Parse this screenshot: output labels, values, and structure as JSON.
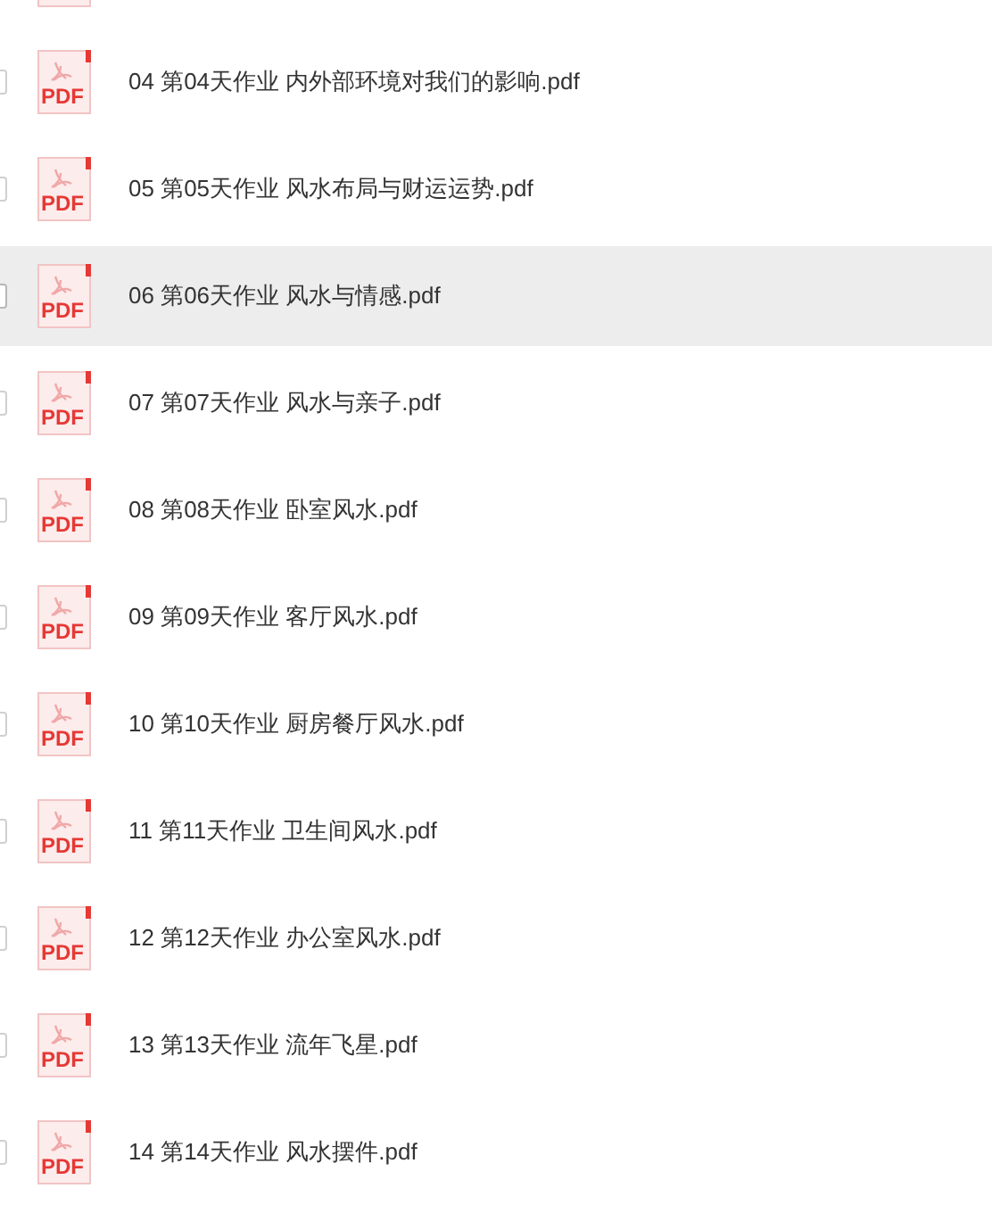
{
  "files": [
    {
      "name": "04 第04天作业 内外部环境对我们的影响.pdf",
      "icon_text": "PDF",
      "selected": false
    },
    {
      "name": "05 第05天作业 风水布局与财运运势.pdf",
      "icon_text": "PDF",
      "selected": false
    },
    {
      "name": "06 第06天作业 风水与情感.pdf",
      "icon_text": "PDF",
      "selected": true
    },
    {
      "name": "07 第07天作业 风水与亲子.pdf",
      "icon_text": "PDF",
      "selected": false
    },
    {
      "name": "08 第08天作业 卧室风水.pdf",
      "icon_text": "PDF",
      "selected": false
    },
    {
      "name": "09 第09天作业 客厅风水.pdf",
      "icon_text": "PDF",
      "selected": false
    },
    {
      "name": "10 第10天作业 厨房餐厅风水.pdf",
      "icon_text": "PDF",
      "selected": false
    },
    {
      "name": "11 第11天作业 卫生间风水.pdf",
      "icon_text": "PDF",
      "selected": false
    },
    {
      "name": "12 第12天作业 办公室风水.pdf",
      "icon_text": "PDF",
      "selected": false
    },
    {
      "name": "13 第13天作业 流年飞星.pdf",
      "icon_text": "PDF",
      "selected": false
    },
    {
      "name": "14 第14天作业 风水摆件.pdf",
      "icon_text": "PDF",
      "selected": false
    }
  ]
}
